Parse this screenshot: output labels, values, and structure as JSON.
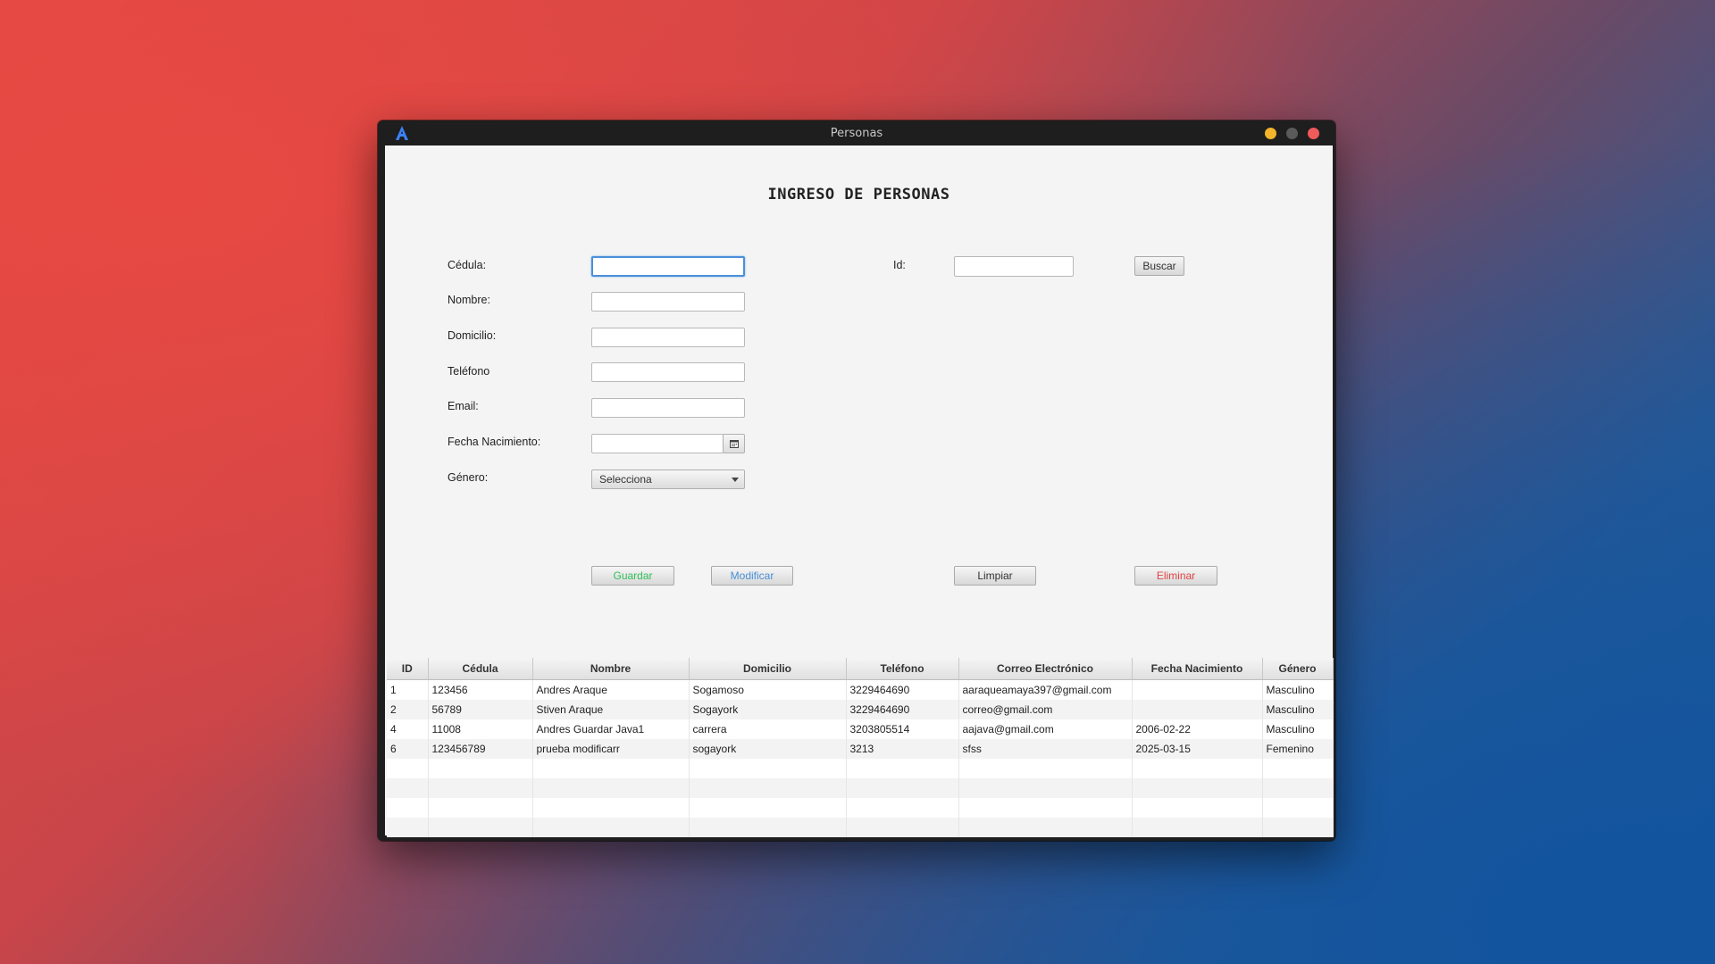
{
  "window": {
    "title": "Personas",
    "controls": {
      "minimize_color": "#f4b52c",
      "maximize_color": "#555555",
      "close_color": "#ef5a5a"
    },
    "logo_icon": "app-logo-icon"
  },
  "form": {
    "heading": "INGRESO DE PERSONAS",
    "labels": {
      "cedula": "Cédula:",
      "nombre": "Nombre:",
      "domicilio": "Domicilio:",
      "telefono": "Teléfono",
      "email": "Email:",
      "fecha_nacimiento": "Fecha Nacimiento:",
      "genero": "Género:",
      "id": "Id:"
    },
    "values": {
      "cedula": "",
      "nombre": "",
      "domicilio": "",
      "telefono": "",
      "email": "",
      "fecha_nacimiento": "",
      "id": ""
    },
    "genero_selected": "Selecciona",
    "calendar_icon": "calendar-icon"
  },
  "buttons": {
    "buscar": "Buscar",
    "guardar": "Guardar",
    "modificar": "Modificar",
    "limpiar": "Limpiar",
    "eliminar": "Eliminar",
    "guardar_color": "#2fbf5a",
    "modificar_color": "#4a8fd6",
    "eliminar_color": "#e04545"
  },
  "table": {
    "columns": [
      "ID",
      "Cédula",
      "Nombre",
      "Domicilio",
      "Teléfono",
      "Correo Electrónico",
      "Fecha Nacimiento",
      "Género"
    ],
    "rows": [
      [
        "1",
        "123456",
        "Andres Araque",
        "Sogamoso",
        "3229464690",
        "aaraqueamaya397@gmail.com",
        "",
        "Masculino"
      ],
      [
        "2",
        "56789",
        "Stiven Araque",
        "Sogayork",
        "3229464690",
        "correo@gmail.com",
        "",
        "Masculino"
      ],
      [
        "4",
        "11008",
        "Andres Guardar Java1",
        "carrera",
        "3203805514",
        "aajava@gmail.com",
        "2006-02-22",
        "Masculino"
      ],
      [
        "6",
        "123456789",
        "prueba modificarr",
        "sogayork",
        "3213",
        "sfss",
        "2025-03-15",
        "Femenino"
      ]
    ]
  }
}
